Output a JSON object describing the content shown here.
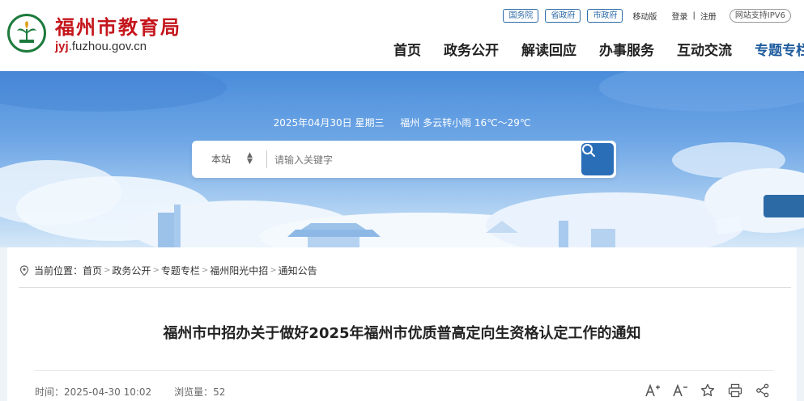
{
  "header": {
    "title": "福州市教育局",
    "domain_prefix": "jyj",
    "domain_suffix": ".fuzhou.gov.cn",
    "toplinks": {
      "state_council": "国务院",
      "province": "省政府",
      "city": "市政府",
      "mobile": "移动版",
      "login": "登录",
      "separator": "|",
      "register": "注册",
      "ipv6": "网站支持IPV6"
    },
    "nav": [
      {
        "label": "首页"
      },
      {
        "label": "政务公开"
      },
      {
        "label": "解读回应"
      },
      {
        "label": "办事服务"
      },
      {
        "label": "互动交流"
      },
      {
        "label": "专题专栏"
      }
    ]
  },
  "banner": {
    "date": "2025年04月30日 星期三",
    "weather": "福州 多云转小雨 16℃～29℃"
  },
  "search": {
    "scope": "本站",
    "placeholder": "请输入关键字"
  },
  "breadcrumb": {
    "prefix": "当前位置：",
    "items": [
      "首页",
      "政务公开",
      "专题专栏",
      "福州阳光中招",
      "通知公告"
    ]
  },
  "article": {
    "title": "福州市中招办关于做好2025年福州市优质普高定向生资格认定工作的通知",
    "time_label": "时间：",
    "time": "2025-04-30 10:02",
    "views_label": "浏览量：",
    "views": "52"
  },
  "colors": {
    "brand_red": "#c4161c",
    "nav_blue": "#1e5b9e",
    "search_button": "#2b6eb8"
  }
}
